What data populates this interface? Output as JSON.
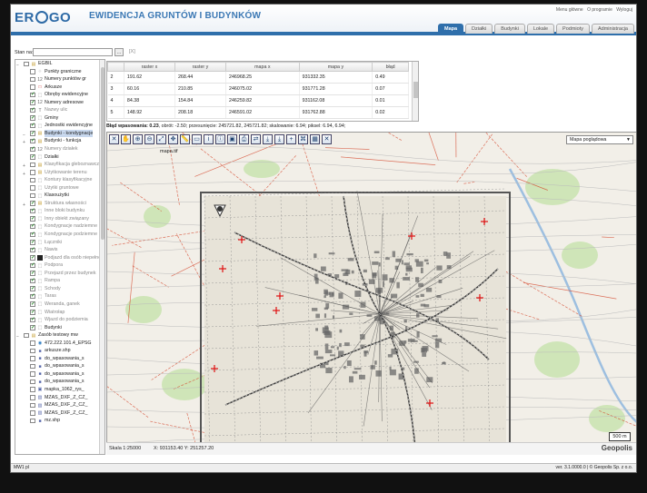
{
  "app": {
    "logo_a": "ER",
    "logo_b": "GO",
    "title": "EWIDENCJA GRUNTÓW I BUDYNKÓW",
    "top_links": [
      "Menu główne",
      "O programie",
      "Wyloguj"
    ]
  },
  "tabs": [
    {
      "label": "Mapa",
      "active": true
    },
    {
      "label": "Działki"
    },
    {
      "label": "Budynki"
    },
    {
      "label": "Lokale"
    },
    {
      "label": "Podmioty"
    },
    {
      "label": "Administracja"
    }
  ],
  "stan": {
    "label": "Stan na:",
    "input_value": "",
    "button": "…",
    "clear": "[X]"
  },
  "tree": {
    "items": [
      {
        "t": "group",
        "open": true,
        "check": false,
        "icon": "folder",
        "label": "EGBIL",
        "indent": 0
      },
      {
        "t": "layer",
        "check": false,
        "icon": "points",
        "label": "Punkty graniczne",
        "indent": 1
      },
      {
        "t": "layer",
        "check": false,
        "icon": "num",
        "label": "Numery punktów gr",
        "indent": 1
      },
      {
        "t": "layer",
        "check": false,
        "icon": "square-red",
        "label": "Arkusze",
        "indent": 1
      },
      {
        "t": "layer",
        "check": true,
        "icon": "poly",
        "label": "Obręby ewidencyjne",
        "indent": 1
      },
      {
        "t": "layer",
        "check": true,
        "icon": "num",
        "label": "Numery adresowe",
        "indent": 1
      },
      {
        "t": "layer",
        "check": true,
        "icon": "text",
        "label": "Nazwy ulic",
        "indent": 1,
        "dim": true
      },
      {
        "t": "layer",
        "check": true,
        "icon": "poly",
        "label": "Gminy",
        "indent": 1
      },
      {
        "t": "layer",
        "check": true,
        "icon": "poly",
        "label": "Jednostki ewidencyjne",
        "indent": 1
      },
      {
        "t": "group",
        "open": true,
        "check": true,
        "icon": "folder",
        "label": "Budynki - kondygnacje",
        "indent": 1,
        "sel": true
      },
      {
        "t": "group",
        "open": false,
        "check": true,
        "icon": "folder",
        "label": "Budynki - funkcja",
        "indent": 1
      },
      {
        "t": "layer",
        "check": true,
        "icon": "num",
        "label": "Numery działek",
        "indent": 1,
        "dim": true
      },
      {
        "t": "layer",
        "check": true,
        "icon": "poly",
        "label": "Działki",
        "indent": 1
      },
      {
        "t": "group",
        "open": false,
        "check": false,
        "icon": "folder",
        "label": "Klasyfikacja gleboznawcza",
        "indent": 1,
        "dim": true
      },
      {
        "t": "group",
        "open": false,
        "check": false,
        "icon": "folder",
        "label": "Użytkowanie terenu",
        "indent": 1,
        "dim": true
      },
      {
        "t": "layer",
        "check": false,
        "icon": "poly",
        "label": "Kontury klasyfikacyjne",
        "indent": 1,
        "dim": true
      },
      {
        "t": "layer",
        "check": false,
        "icon": "poly",
        "label": "Użytki gruntowe",
        "indent": 1,
        "dim": true
      },
      {
        "t": "layer",
        "check": false,
        "icon": "poly",
        "label": "Klasoużytki",
        "indent": 1
      },
      {
        "t": "group",
        "open": false,
        "check": true,
        "icon": "folder",
        "label": "Struktura własności",
        "indent": 1,
        "dim": true
      },
      {
        "t": "layer",
        "check": true,
        "icon": "poly",
        "label": "Inne bloki budynku",
        "indent": 1,
        "dim": true
      },
      {
        "t": "layer",
        "check": true,
        "icon": "poly",
        "label": "Inny obiekt związany",
        "indent": 1,
        "dim": true
      },
      {
        "t": "layer",
        "check": true,
        "icon": "poly",
        "label": "Kondygnacje nadziemne",
        "indent": 1,
        "dim": true
      },
      {
        "t": "layer",
        "check": true,
        "icon": "poly",
        "label": "Kondygnacje podziemne",
        "indent": 1,
        "dim": true
      },
      {
        "t": "layer",
        "check": true,
        "icon": "poly",
        "label": "Łączniki",
        "indent": 1,
        "dim": true
      },
      {
        "t": "layer",
        "check": true,
        "icon": "poly",
        "label": "Nawis",
        "indent": 1,
        "dim": true
      },
      {
        "t": "layer",
        "check": true,
        "icon": "black",
        "label": "Podjazd dla osób niepełnosprawnych",
        "indent": 1,
        "dim": true
      },
      {
        "t": "layer",
        "check": true,
        "icon": "poly",
        "label": "Podpora",
        "indent": 1,
        "dim": true
      },
      {
        "t": "layer",
        "check": true,
        "icon": "poly",
        "label": "Przejazd przez budynek",
        "indent": 1,
        "dim": true
      },
      {
        "t": "layer",
        "check": true,
        "icon": "poly",
        "label": "Rampa",
        "indent": 1,
        "dim": true
      },
      {
        "t": "layer",
        "check": true,
        "icon": "poly",
        "label": "Schody",
        "indent": 1,
        "dim": true
      },
      {
        "t": "layer",
        "check": true,
        "icon": "poly",
        "label": "Taras",
        "indent": 1,
        "dim": true
      },
      {
        "t": "layer",
        "check": true,
        "icon": "poly",
        "label": "Weranda, ganek",
        "indent": 1,
        "dim": true
      },
      {
        "t": "layer",
        "check": true,
        "icon": "poly",
        "label": "Wiatrołap",
        "indent": 1,
        "dim": true
      },
      {
        "t": "layer",
        "check": true,
        "icon": "poly",
        "label": "Wjazd do podziemia",
        "indent": 1,
        "dim": true
      },
      {
        "t": "layer",
        "check": true,
        "icon": "poly",
        "label": "Budynki",
        "indent": 1
      },
      {
        "t": "group",
        "open": true,
        "check": false,
        "icon": "folder",
        "label": "Zasób testowy mw",
        "indent": 0
      },
      {
        "t": "layer",
        "check": false,
        "icon": "globe",
        "label": "472.222.101.4_EPSG",
        "indent": 1
      },
      {
        "t": "layer",
        "check": false,
        "icon": "shp",
        "label": "arkusze.shp",
        "indent": 1
      },
      {
        "t": "layer",
        "check": false,
        "icon": "shp",
        "label": "do_wpasowania_s",
        "indent": 1
      },
      {
        "t": "layer",
        "check": false,
        "icon": "shp",
        "label": "do_wpasowania_s",
        "indent": 1
      },
      {
        "t": "layer",
        "check": false,
        "icon": "shp",
        "label": "do_wpasowania_s",
        "indent": 1
      },
      {
        "t": "layer",
        "check": false,
        "icon": "shp",
        "label": "do_wpasowania_s",
        "indent": 1
      },
      {
        "t": "layer",
        "check": false,
        "icon": "img",
        "label": "mapka_1062_rys_",
        "indent": 1
      },
      {
        "t": "layer",
        "check": false,
        "icon": "dxf",
        "label": "MZAS_DXF_Z_CZ_",
        "indent": 1
      },
      {
        "t": "layer",
        "check": false,
        "icon": "dxf",
        "label": "MZAS_DXF_Z_CZ_",
        "indent": 1
      },
      {
        "t": "layer",
        "check": false,
        "icon": "dxf",
        "label": "MZAS_DXF_Z_CZ_",
        "indent": 1
      },
      {
        "t": "layer",
        "check": false,
        "icon": "shp",
        "label": "mz.shp",
        "indent": 1
      }
    ]
  },
  "grid": {
    "headers": [
      "",
      "raster x",
      "raster y",
      "mapa x",
      "mapa y",
      "błąd"
    ],
    "rows": [
      [
        "2",
        "191.62",
        "268.44",
        "246968.25",
        "931332.35",
        "0.49"
      ],
      [
        "3",
        "60.16",
        "210.85",
        "246075.02",
        "931771.28",
        "0.07"
      ],
      [
        "4",
        "84.38",
        "154.84",
        "246259.82",
        "931162.08",
        "0.01"
      ],
      [
        "5",
        "148.92",
        "208.18",
        "246591.02",
        "931762.88",
        "0.02"
      ]
    ]
  },
  "status": {
    "fit_label": "Błąd wpasowania:",
    "fit_value": "0.23",
    "rest": ", obrót: -2.50; przesunięcie: 245721.82, 245721.82; skalowanie: 6.94; piksel: 6.94, 6.94;"
  },
  "map": {
    "toolbar_icons": [
      "close-icon",
      "pan-icon",
      "zoom-in-icon",
      "zoom-out-icon",
      "zoom-extent-icon",
      "move-icon",
      "measure-length-icon",
      "measure-area-icon",
      "info-icon",
      "info-list-icon",
      "select-icon",
      "print-icon",
      "export-icon",
      "download-icon",
      "download-icon",
      "add-point-icon",
      "fit-icon",
      "save-icon",
      "delete-icon"
    ],
    "toolbar_glyphs": [
      "✕",
      "✋",
      "⊕",
      "⊖",
      "⤢",
      "✥",
      "📏",
      "▭",
      "i",
      "ⓘ",
      "▣",
      "⎙",
      "⇄",
      "⤓",
      "⤓",
      "+",
      "⌘",
      "▦",
      "✕"
    ],
    "tif_file": "mapa.tif",
    "basemap": "Mapa poglądowa",
    "scale_bar": "500 m",
    "scale_label": "Skala 1:25000",
    "coord_x": "X: 931153.40",
    "coord_y": "Y: 251257.20",
    "brand": "Geopolis",
    "colors": {
      "street": "#d4452a",
      "base": "#f2efe8",
      "park": "#cfe5b8",
      "water": "#9dbfe0",
      "scan_bg": "#e7e3d8"
    }
  },
  "footer": {
    "left": "MW1   pl",
    "right": "ver. 3.1.0000.0 | © Geopolis Sp. z o.o."
  }
}
